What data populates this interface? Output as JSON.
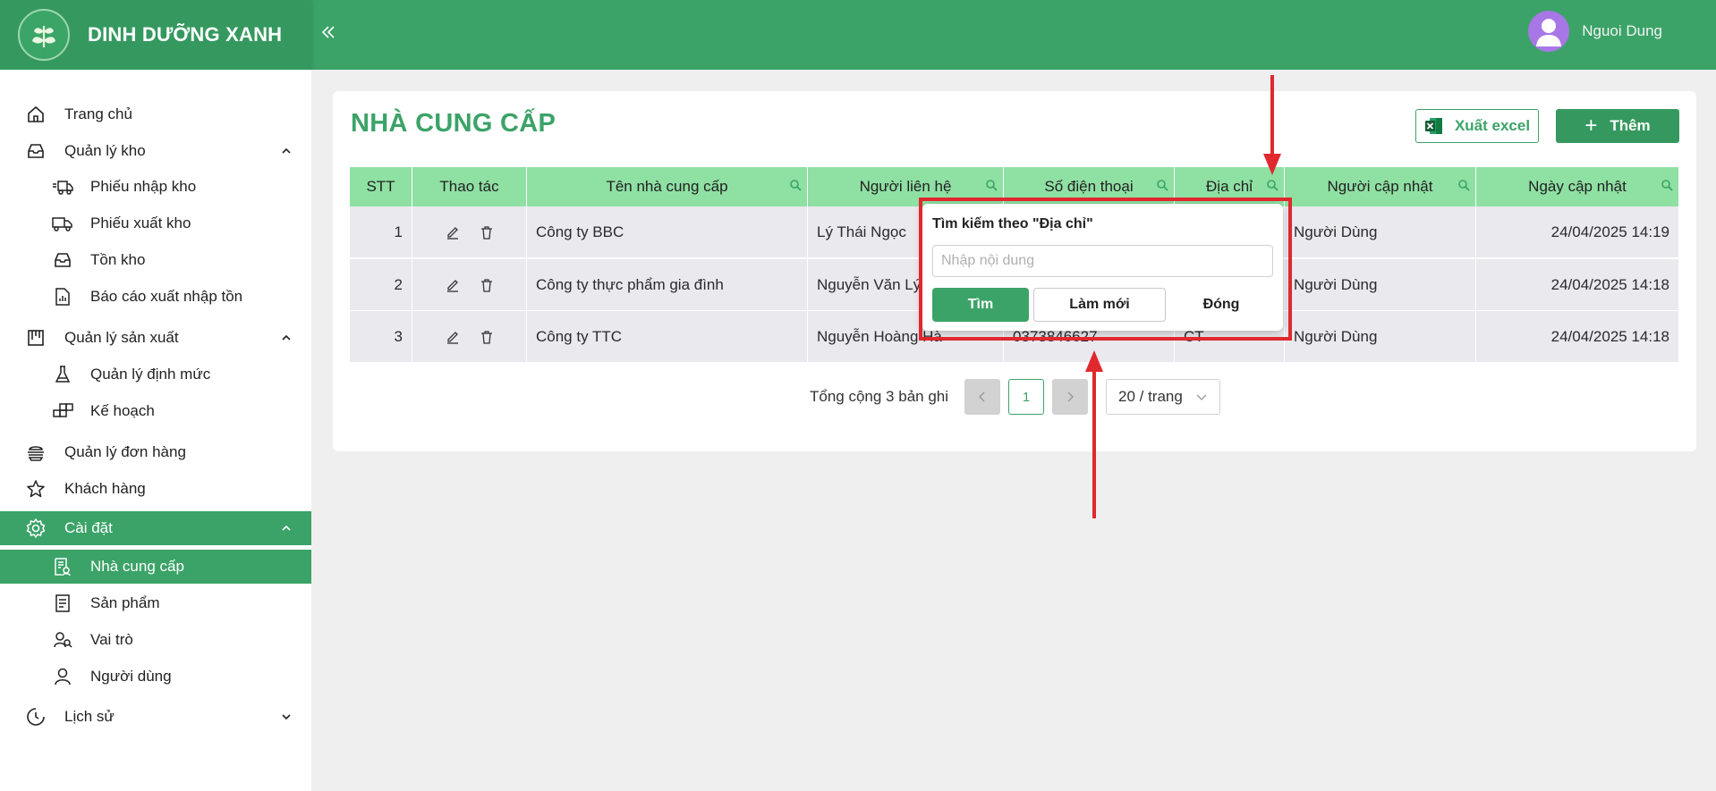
{
  "header": {
    "brand_name": "DINH DƯỠNG XANH",
    "collapse_icon": "double-chevron-left-icon",
    "user_name": "Nguoi Dung"
  },
  "sidebar": {
    "items": [
      {
        "label": "Trang chủ",
        "icon": "home-icon"
      },
      {
        "label": "Quản lý kho",
        "icon": "inbox-icon",
        "expanded": true
      },
      {
        "label": "Phiếu nhập kho",
        "icon": "truck-in-icon"
      },
      {
        "label": "Phiếu xuất kho",
        "icon": "truck-out-icon"
      },
      {
        "label": "Tồn kho",
        "icon": "inbox-icon"
      },
      {
        "label": "Báo cáo xuất nhập tồn",
        "icon": "report-icon"
      },
      {
        "label": "Quản lý sản xuất",
        "icon": "factory-icon",
        "expanded": true
      },
      {
        "label": "Quản lý định mức",
        "icon": "flask-icon"
      },
      {
        "label": "Kế hoạch",
        "icon": "blocks-icon"
      },
      {
        "label": "Quản lý đơn hàng",
        "icon": "order-icon"
      },
      {
        "label": "Khách hàng",
        "icon": "star-icon"
      },
      {
        "label": "Cài đặt",
        "icon": "gear-icon",
        "expanded": true,
        "active_group": true
      },
      {
        "label": "Nhà cung cấp",
        "icon": "supplier-doc-icon",
        "active": true
      },
      {
        "label": "Sản phẩm",
        "icon": "document-icon"
      },
      {
        "label": "Vai trò",
        "icon": "users-icon"
      },
      {
        "label": "Người dùng",
        "icon": "user-icon"
      },
      {
        "label": "Lịch sử",
        "icon": "clock-icon",
        "expanded": false
      }
    ]
  },
  "main": {
    "title": "NHÀ CUNG CẤP",
    "export_label": "Xuất excel",
    "add_label": "Thêm",
    "table": {
      "columns": [
        "STT",
        "Thao tác",
        "Tên nhà cung cấp",
        "Người liên hệ",
        "Số điện thoại",
        "Địa chỉ",
        "Người cập nhật",
        "Ngày cập nhật"
      ],
      "rows": [
        {
          "stt": "1",
          "name": "Công ty BBC",
          "contact": "Lý Thái Ngọc",
          "phone": "",
          "address": "",
          "updated_by": "Người Dùng",
          "updated_at": "24/04/2025 14:19"
        },
        {
          "stt": "2",
          "name": "Công ty thực phẩm gia đình",
          "contact": "Nguyễn Văn Lý",
          "phone": "",
          "address": "",
          "updated_by": "Người Dùng",
          "updated_at": "24/04/2025 14:18"
        },
        {
          "stt": "3",
          "name": "Công ty TTC",
          "contact": "Nguyễn Hoàng Hà",
          "phone": "0373846627",
          "address": "CT",
          "updated_by": "Người Dùng",
          "updated_at": "24/04/2025 14:18"
        }
      ]
    },
    "pagination": {
      "total_text": "Tổng cộng 3 bản ghi",
      "current_page": "1",
      "page_size": "20 / trang"
    }
  },
  "filter_popover": {
    "title": "Tìm kiếm theo \"Địa chỉ\"",
    "placeholder": "Nhập nội dung",
    "search_label": "Tìm",
    "reset_label": "Làm mới",
    "close_label": "Đóng"
  },
  "colors": {
    "primary": "#3ba368",
    "header_bg": "#3ba368",
    "table_header": "#8fe0a3",
    "annotation_red": "#e0282f"
  }
}
